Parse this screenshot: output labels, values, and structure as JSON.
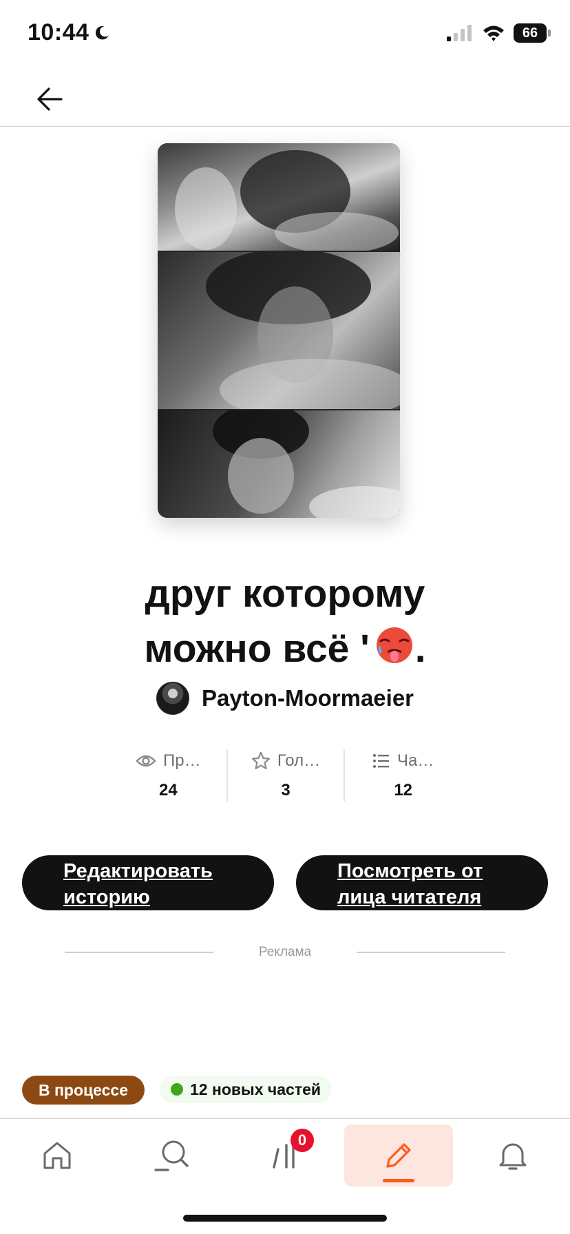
{
  "status_bar": {
    "time": "10:44",
    "battery": "66",
    "icons": [
      "moon-icon",
      "signal-icon",
      "wifi-icon",
      "battery-icon"
    ]
  },
  "nav": {
    "back_icon": "arrow-left-icon"
  },
  "story": {
    "title_line1": "друг которому",
    "title_line2": "можно всё '",
    "title_end": ".",
    "title_emoji": "hot-face-emoji",
    "author": "Payton-Moormaeier"
  },
  "stats": [
    {
      "icon": "eye-icon",
      "label": "Пр…",
      "value": "24"
    },
    {
      "icon": "star-icon",
      "label": "Гол…",
      "value": "3"
    },
    {
      "icon": "list-icon",
      "label": "Ча…",
      "value": "12"
    }
  ],
  "buttons": {
    "edit": "Редактировать историю",
    "preview": "Посмотреть от лица читателя"
  },
  "ad_label": "Реклама",
  "tags": {
    "status": "В процессе",
    "new_parts": "12 новых частей"
  },
  "tab_bar": {
    "tabs": [
      {
        "icon": "home-icon",
        "active": false
      },
      {
        "icon": "search-icon",
        "active": false
      },
      {
        "icon": "library-icon",
        "active": false,
        "badge": "0"
      },
      {
        "icon": "pencil-icon",
        "active": true
      },
      {
        "icon": "bell-icon",
        "active": false
      }
    ],
    "accent": "#ff5c1a",
    "badge_color": "#e8112d"
  },
  "colors": {
    "primary_dark": "#121212",
    "status_tag": "#8c4a12",
    "new_parts_dot": "#3fa51b"
  }
}
